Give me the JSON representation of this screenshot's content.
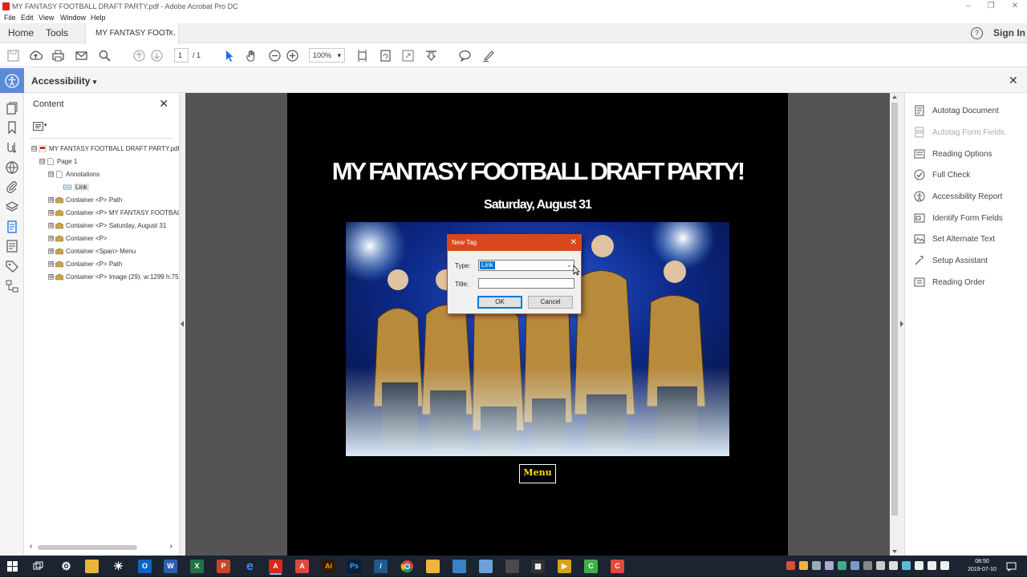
{
  "window": {
    "title": "MY FANTASY FOOTBALL DRAFT PARTY.pdf - Adobe Acrobat Pro DC",
    "controls": [
      "–",
      "❐",
      "✕"
    ]
  },
  "menubar": [
    "File",
    "Edit",
    "View",
    "Window",
    "Help"
  ],
  "tabs": {
    "home": "Home",
    "tools": "Tools",
    "document": "MY FANTASY FOOT...",
    "document_close": "×",
    "help": "?",
    "sign_in": "Sign In"
  },
  "toolbar": {
    "page_current": "1",
    "page_total": "/ 1",
    "zoom": "100%",
    "zoom_arrow": "▾"
  },
  "accessibility_bar": {
    "title": "Accessibility",
    "caret": "▾",
    "close": "✕"
  },
  "content_panel": {
    "title": "Content",
    "close": "✕",
    "options_caret": "▾",
    "tree": [
      {
        "label": "MY FANTASY FOOTBALL DRAFT PARTY.pdf",
        "exp": "⊟",
        "icon": "pdf-icon"
      },
      {
        "label": "Page 1",
        "exp": "⊟",
        "icon": "page-icon"
      },
      {
        "label": "Annotations",
        "exp": "⊟",
        "icon": "page-icon"
      },
      {
        "label": "Link",
        "exp": "",
        "icon": "link-annotation-icon"
      },
      {
        "label": "Container <P> Path",
        "exp": "⊞",
        "icon": "container-icon"
      },
      {
        "label": "Container <P> MY FANTASY FOOTBAL",
        "exp": "⊞",
        "icon": "container-icon"
      },
      {
        "label": "Container <P> Saturday, August 31",
        "exp": "⊞",
        "icon": "container-icon"
      },
      {
        "label": "Container <P>",
        "exp": "⊞",
        "icon": "container-icon"
      },
      {
        "label": "Container <Span> Menu",
        "exp": "⊞",
        "icon": "container-icon"
      },
      {
        "label": "Container <P>  Path",
        "exp": "⊞",
        "icon": "container-icon"
      },
      {
        "label": "Container <P> Image (29): w:1299 h:75",
        "exp": "⊞",
        "icon": "container-icon"
      }
    ],
    "scroll_left": "‹",
    "scroll_right": "›"
  },
  "document": {
    "title": "MY FANTASY FOOTBALL DRAFT PARTY!",
    "date": "Saturday, August 31",
    "menu_button": "Menu"
  },
  "right_panel": {
    "items": [
      {
        "label": "Autotag Document",
        "icon": "autotag-icon",
        "disabled": false
      },
      {
        "label": "Autotag Form Fields",
        "icon": "autotag-form-icon",
        "disabled": true
      },
      {
        "label": "Reading Options",
        "icon": "reading-options-icon",
        "disabled": false
      },
      {
        "label": "Full Check",
        "icon": "check-icon",
        "disabled": false
      },
      {
        "label": "Accessibility Report",
        "icon": "report-icon",
        "disabled": false
      },
      {
        "label": "Identify Form Fields",
        "icon": "form-fields-icon",
        "disabled": false
      },
      {
        "label": "Set Alternate Text",
        "icon": "alt-text-icon",
        "disabled": false
      },
      {
        "label": "Setup Assistant",
        "icon": "wand-icon",
        "disabled": false
      },
      {
        "label": "Reading Order",
        "icon": "reading-order-icon",
        "disabled": false
      }
    ]
  },
  "dialog": {
    "title": "New Tag",
    "close": "✕",
    "type_label": "Type:",
    "type_value": "Link",
    "type_arrow": "⌄",
    "title_label": "Title:",
    "title_value": "",
    "ok": "OK",
    "cancel": "Cancel"
  },
  "taskbar": {
    "time": "08:50",
    "date": "2019-07-10"
  },
  "colors": {
    "accent_blue": "#5c8bd6",
    "dialog_header": "#d9481c",
    "page_bg": "#000000",
    "menu_text": "#ffe000"
  }
}
